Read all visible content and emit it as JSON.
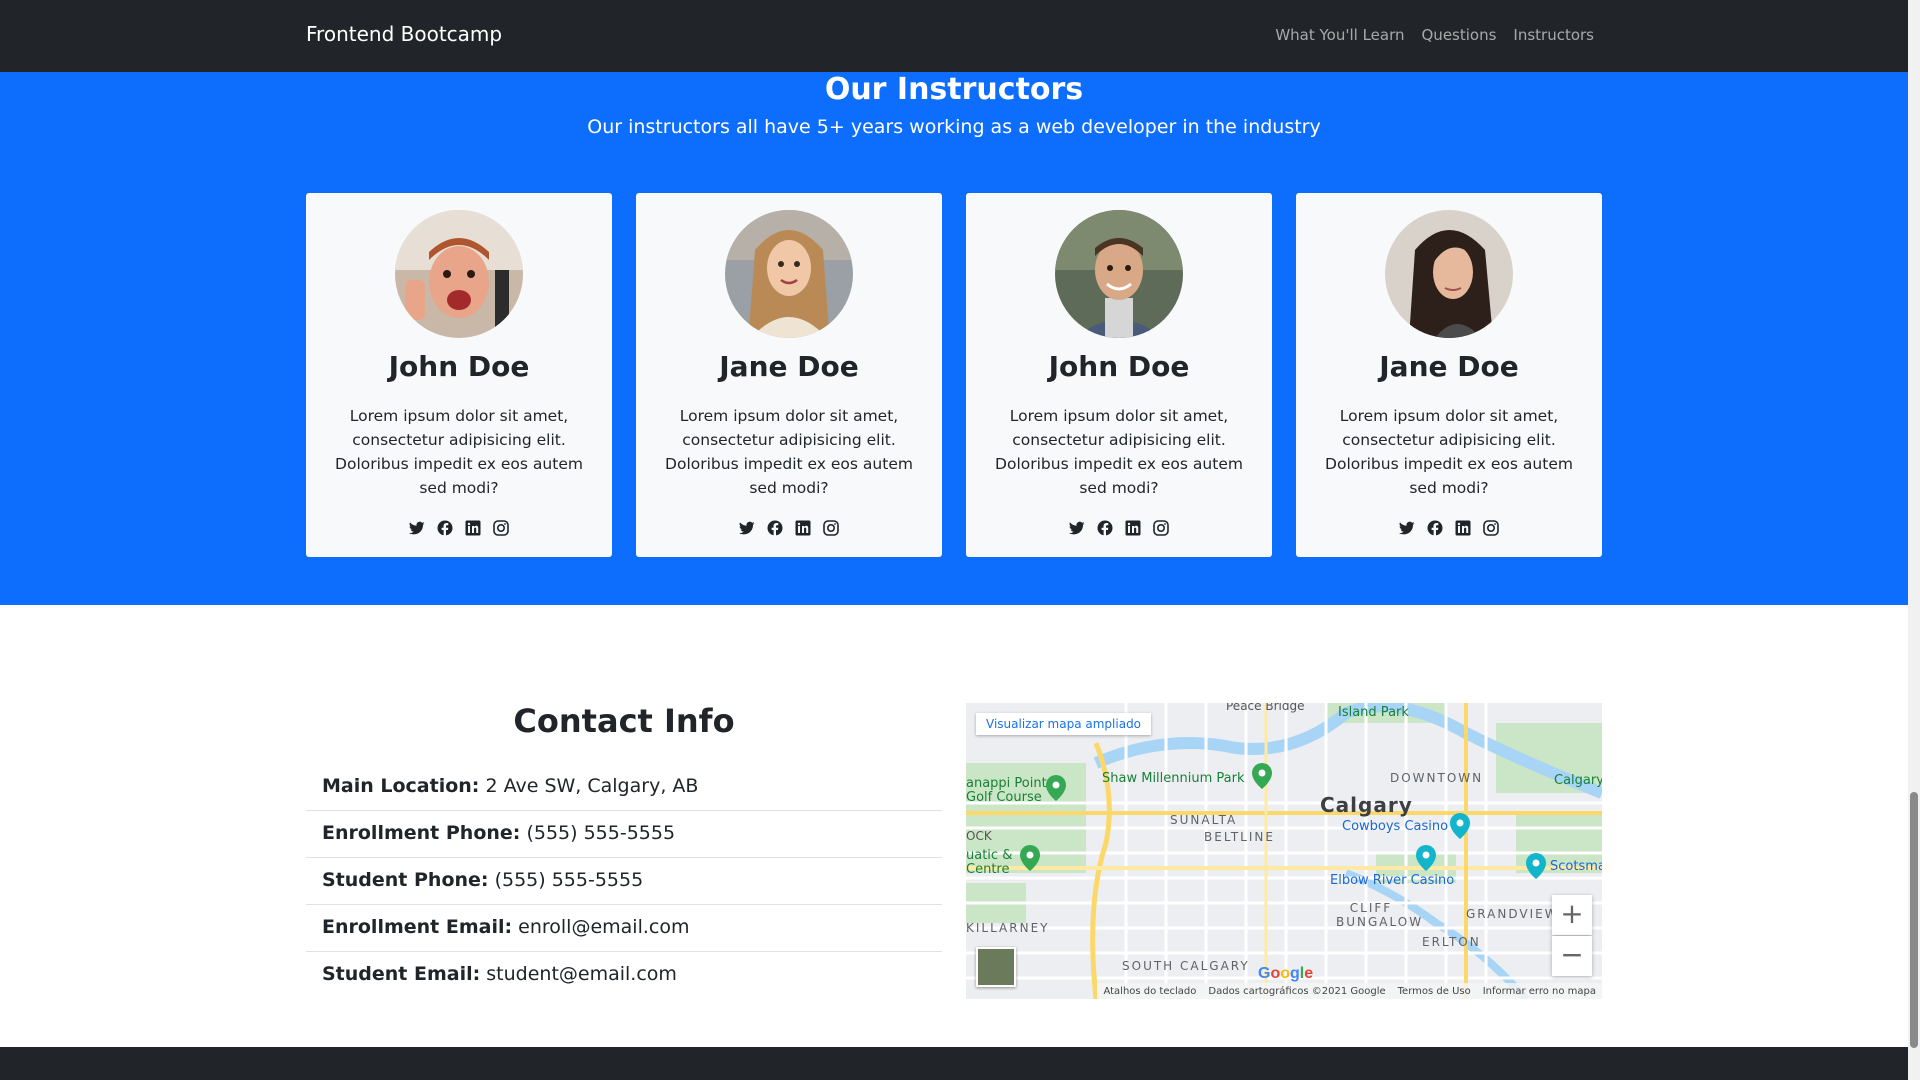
{
  "navbar": {
    "brand": "Frontend Bootcamp",
    "links": [
      "What You'll Learn",
      "Questions",
      "Instructors"
    ]
  },
  "instructors": {
    "title": "Our Instructors",
    "lead": "Our instructors all have 5+ years working as a web developer in the industry",
    "cards": [
      {
        "name": "John Doe",
        "text": "Lorem ipsum dolor sit amet, consectetur adipisicing elit. Doloribus impedit ex eos autem sed modi?"
      },
      {
        "name": "Jane Doe",
        "text": "Lorem ipsum dolor sit amet, consectetur adipisicing elit. Doloribus impedit ex eos autem sed modi?"
      },
      {
        "name": "John Doe",
        "text": "Lorem ipsum dolor sit amet, consectetur adipisicing elit. Doloribus impedit ex eos autem sed modi?"
      },
      {
        "name": "Jane Doe",
        "text": "Lorem ipsum dolor sit amet, consectetur adipisicing elit. Doloribus impedit ex eos autem sed modi?"
      }
    ],
    "social_icons": [
      "twitter-icon",
      "facebook-icon",
      "linkedin-icon",
      "instagram-icon"
    ]
  },
  "contact": {
    "title": "Contact Info",
    "rows": [
      {
        "label": "Main Location:",
        "value": "2 Ave SW, Calgary, AB"
      },
      {
        "label": "Enrollment Phone:",
        "value": "(555) 555-5555"
      },
      {
        "label": "Student Phone:",
        "value": "(555) 555-5555"
      },
      {
        "label": "Enrollment Email:",
        "value": "enroll@email.com"
      },
      {
        "label": "Student Email:",
        "value": "student@email.com"
      }
    ]
  },
  "map": {
    "view_larger": "Visualizar mapa ampliado",
    "labels": {
      "peace_bridge": "Peace Bridge",
      "island_park": "Island Park",
      "shaw": "Shaw Millennium Park",
      "downtown": "DOWNTOWN",
      "calgary": "Calgary",
      "calgary_e": "Calgary",
      "shaganappi": "anappi Point Golf Course",
      "sunalta": "SUNALTA",
      "beltline": "BELTLINE",
      "cowboys": "Cowboys Casino",
      "aquatic": "uatic & Centre",
      "scotsman": "Scotsman's H",
      "elbow": "Elbow River Casino",
      "cliff": "CLIFF BUNGALOW",
      "grandview": "GRANDVIEW",
      "killarney": "KILLARNEY",
      "erlton": "ERLTON",
      "south_calgary": "SOUTH CALGARY",
      "rock": "OCK"
    },
    "zoom_in": "+",
    "zoom_out": "−",
    "google": "Google",
    "attribution": [
      "Atalhos do teclado",
      "Dados cartográficos ©2021 Google",
      "Termos de Uso",
      "Informar erro no mapa"
    ]
  }
}
